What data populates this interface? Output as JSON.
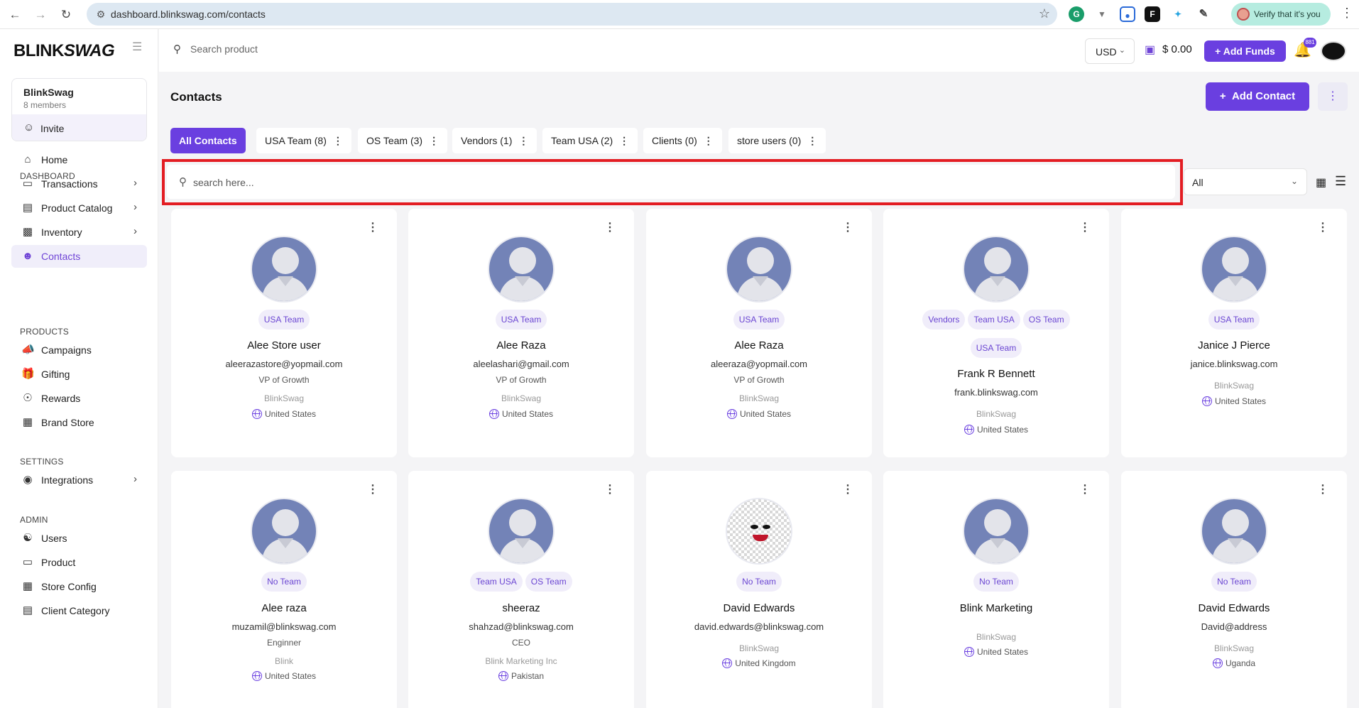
{
  "browser": {
    "url": "dashboard.blinkswag.com/contacts",
    "verify_label": "Verify that it's you"
  },
  "sidebar": {
    "logo_left": "BLINK",
    "logo_right": "SWAG",
    "org_name": "BlinkSwag",
    "org_members": "8 members",
    "invite_label": "Invite",
    "sections": {
      "dashboard": "DASHBOARD",
      "products": "PRODUCTS",
      "settings": "SETTINGS",
      "admin": "ADMIN"
    },
    "items": {
      "home": "Home",
      "transactions": "Transactions",
      "product_catalog": "Product Catalog",
      "inventory": "Inventory",
      "contacts": "Contacts",
      "campaigns": "Campaigns",
      "gifting": "Gifting",
      "rewards": "Rewards",
      "brand_store": "Brand Store",
      "integrations": "Integrations",
      "users": "Users",
      "product": "Product",
      "store_config": "Store Config",
      "client_category": "Client Category"
    }
  },
  "topbar": {
    "search_placeholder": "Search product",
    "currency": "USD",
    "balance": "$ 0.00",
    "add_funds": "Add Funds",
    "notification_count": "881"
  },
  "page": {
    "title": "Contacts",
    "add_contact": "Add Contact"
  },
  "tabs": [
    {
      "label": "All Contacts"
    },
    {
      "label": "USA Team (8)"
    },
    {
      "label": "OS Team (3)"
    },
    {
      "label": "Vendors (1)"
    },
    {
      "label": "Team USA (2)"
    },
    {
      "label": "Clients (0)"
    },
    {
      "label": "store users (0)"
    }
  ],
  "filter": {
    "search_placeholder": "search here...",
    "select_value": "All"
  },
  "contacts": [
    {
      "tags": [
        "USA Team"
      ],
      "name": "Alee Store user",
      "email": "aleerazastore@yopmail.com",
      "title": "VP of Growth",
      "company": "BlinkSwag",
      "country": "United States"
    },
    {
      "tags": [
        "USA Team"
      ],
      "name": "Alee Raza",
      "email": "aleelashari@gmail.com",
      "title": "VP of Growth",
      "company": "BlinkSwag",
      "country": "United States"
    },
    {
      "tags": [
        "USA Team"
      ],
      "name": "Alee Raza",
      "email": "aleeraza@yopmail.com",
      "title": "VP of Growth",
      "company": "BlinkSwag",
      "country": "United States"
    },
    {
      "tags": [
        "Vendors",
        "Team USA",
        "OS Team"
      ],
      "tags2": [
        "USA Team"
      ],
      "name": "Frank R Bennett",
      "email": "frank.blinkswag.com",
      "company": "BlinkSwag",
      "country": "United States"
    },
    {
      "tags": [
        "USA Team"
      ],
      "name": "Janice J Pierce",
      "email": "janice.blinkswag.com",
      "company": "BlinkSwag",
      "country": "United States"
    },
    {
      "tags": [
        "No Team"
      ],
      "name": "Alee raza",
      "email": "muzamil@blinkswag.com",
      "title": "Enginner",
      "company": "Blink",
      "country": "United States"
    },
    {
      "tags": [
        "Team USA",
        "OS Team"
      ],
      "name": "sheeraz",
      "email": "shahzad@blinkswag.com",
      "title": "CEO",
      "company": "Blink Marketing Inc",
      "country": "Pakistan"
    },
    {
      "tags": [
        "No Team"
      ],
      "name": "David Edwards",
      "email": "david.edwards@blinkswag.com",
      "company": "BlinkSwag",
      "country": "United Kingdom"
    },
    {
      "tags": [
        "No Team"
      ],
      "name": "Blink Marketing",
      "company": "BlinkSwag",
      "country": "United States"
    },
    {
      "tags": [
        "No Team"
      ],
      "name": "David Edwards",
      "email": "David@address",
      "company": "BlinkSwag",
      "country": "Uganda"
    }
  ],
  "colors": {
    "accent": "#6a3fe0",
    "highlight": "#e31d23",
    "tag_bg": "#f0edfa",
    "avatar_bg": "#7383b7"
  }
}
